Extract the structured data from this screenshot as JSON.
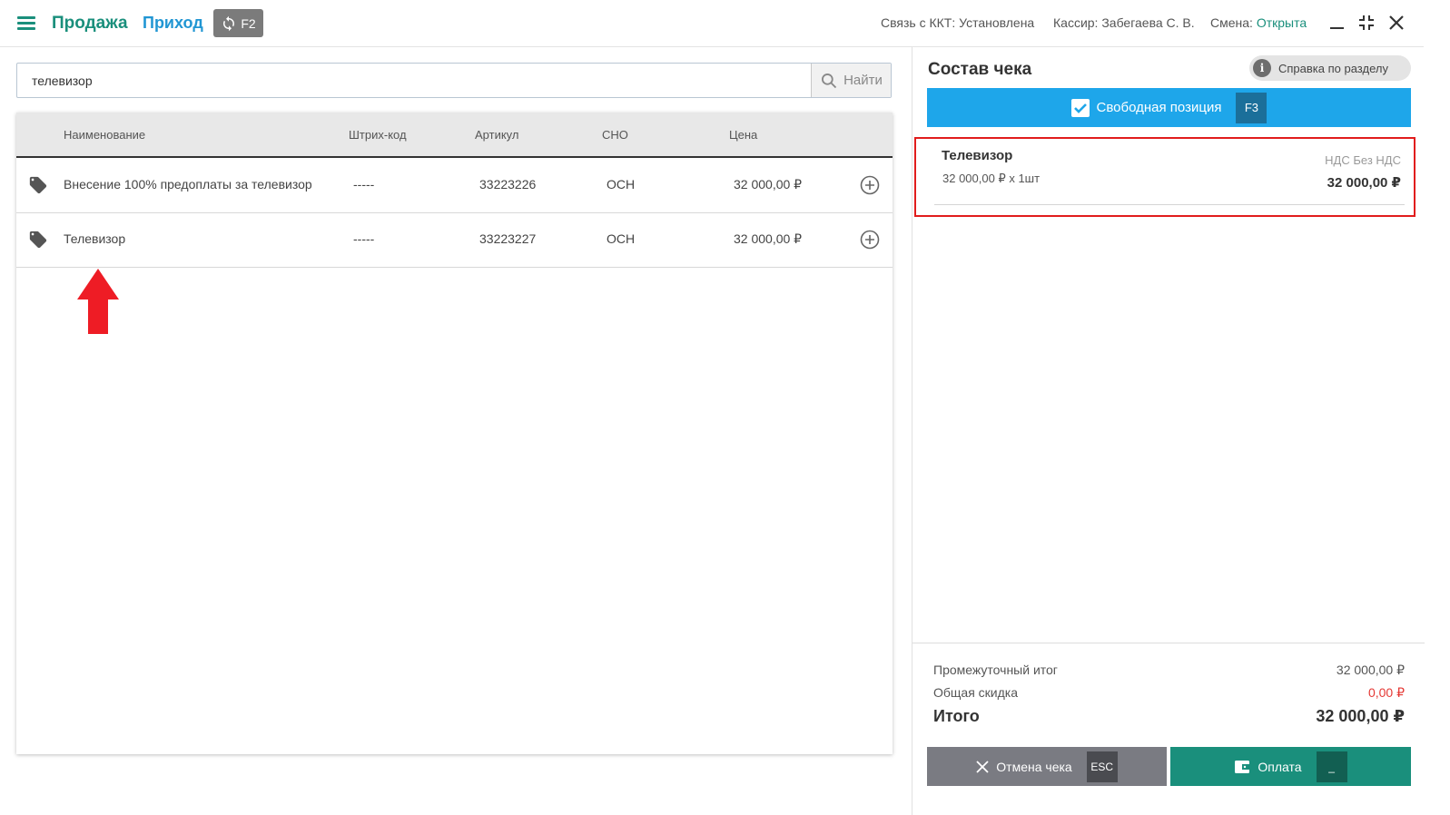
{
  "header": {
    "mode_sale": "Продажа",
    "mode_income": "Приход",
    "switch_key": "F2",
    "kkt_label": "Связь с ККТ: ",
    "kkt_value": "Установлена",
    "cashier_label": "Кассир: ",
    "cashier_value": "Забегаева С. В.",
    "shift_label": "Смена: ",
    "shift_value": "Открыта"
  },
  "search": {
    "value": "телевизор",
    "button_label": "Найти"
  },
  "table": {
    "columns": [
      "Наименование",
      "Штрих-код",
      "Артикул",
      "СНО",
      "Цена"
    ],
    "rows": [
      {
        "name": "Внесение 100% предоплаты за телевизор",
        "barcode": "-----",
        "sku": "33223226",
        "tax_system": "ОСН",
        "price": "32 000,00 ₽"
      },
      {
        "name": "Телевизор",
        "barcode": "-----",
        "sku": "33223227",
        "tax_system": "ОСН",
        "price": "32 000,00 ₽"
      }
    ]
  },
  "receipt": {
    "title": "Состав чека",
    "help_label": "Справка по разделу",
    "free_position_label": "Свободная позиция",
    "free_position_key": "F3",
    "item": {
      "name": "Телевизор",
      "qty_line": "32 000,00 ₽ x 1шт",
      "vat": "НДС Без НДС",
      "total": "32 000,00 ₽"
    },
    "subtotal_label": "Промежуточный итог",
    "subtotal_value": "32 000,00 ₽",
    "discount_label": "Общая скидка",
    "discount_value": "0,00 ₽",
    "total_label": "Итого",
    "total_value": "32 000,00 ₽",
    "cancel_label": "Отмена чека",
    "cancel_key": "ESC",
    "pay_label": "Оплата",
    "pay_key": "_"
  },
  "colors": {
    "accent_green": "#1a8f7c",
    "accent_blue": "#2196d3",
    "highlight_red": "#e11c1c",
    "discount_red": "#e53935"
  }
}
